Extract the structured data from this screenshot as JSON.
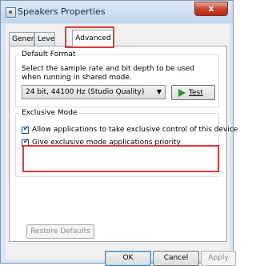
{
  "window": {
    "title": "Speakers Properties",
    "close_label": "x"
  },
  "tabs": [
    {
      "label": "General"
    },
    {
      "label": "Leve"
    },
    {
      "label": "Advanced"
    }
  ],
  "default_format": {
    "title": "Default Format",
    "description": "Select the sample rate and bit depth to be used when running in shared mode.",
    "selected_format": "24 bit, 44100 Hz (Studio Quality)",
    "test_label": "Test"
  },
  "exclusive_mode": {
    "title": "Exclusive Mode",
    "options": [
      {
        "label": "Allow applications to take exclusive control of this device",
        "checked": true
      },
      {
        "label": "Give exclusive mode applications priority",
        "checked": true
      }
    ]
  },
  "buttons": {
    "restore_defaults": "Restore Defaults",
    "ok": "OK",
    "cancel": "Cancel",
    "apply": "Apply"
  },
  "colors": {
    "highlight": "#e03a3a",
    "close_button": "#c7442f"
  }
}
